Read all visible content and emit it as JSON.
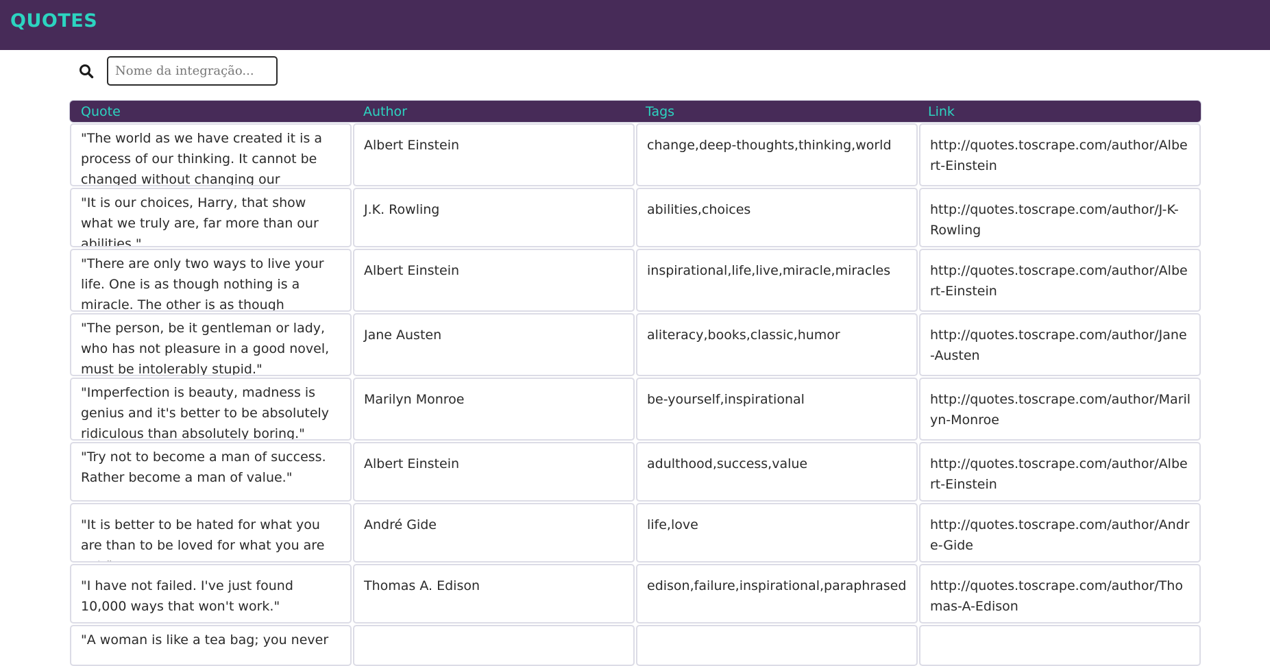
{
  "app": {
    "title": "QUOTES"
  },
  "search": {
    "placeholder": "Nome da integração..."
  },
  "table": {
    "headers": [
      "Quote",
      "Author",
      "Tags",
      "Link"
    ],
    "rows": [
      {
        "quote": "\"The world as we have created it is a process of our thinking. It cannot be changed without changing our thinking.\"",
        "author": "Albert Einstein",
        "tags": "change,deep-thoughts,thinking,world",
        "link": "http://quotes.toscrape.com/author/Albert-Einstein"
      },
      {
        "quote": "\"It is our choices, Harry, that show what we truly are, far more than our abilities.\"",
        "author": "J.K. Rowling",
        "tags": "abilities,choices",
        "link": "http://quotes.toscrape.com/author/J-K-Rowling"
      },
      {
        "quote": "\"There are only two ways to live your life. One is as though nothing is a miracle. The other is as though everything is a miracle.\"",
        "author": "Albert Einstein",
        "tags": "inspirational,life,live,miracle,miracles",
        "link": "http://quotes.toscrape.com/author/Albert-Einstein"
      },
      {
        "quote": "\"The person, be it gentleman or lady, who has not pleasure in a good novel, must be intolerably stupid.\"",
        "author": "Jane Austen",
        "tags": "aliteracy,books,classic,humor",
        "link": "http://quotes.toscrape.com/author/Jane-Austen"
      },
      {
        "quote": "\"Imperfection is beauty, madness is genius and it's better to be absolutely ridiculous than absolutely boring.\"",
        "author": "Marilyn Monroe",
        "tags": "be-yourself,inspirational",
        "link": "http://quotes.toscrape.com/author/Marilyn-Monroe"
      },
      {
        "quote": "\"Try not to become a man of success. Rather become a man of value.\"",
        "author": "Albert Einstein",
        "tags": "adulthood,success,value",
        "link": "http://quotes.toscrape.com/author/Albert-Einstein"
      },
      {
        "quote": "\"It is better to be hated for what you are than to be loved for what you are not.\"",
        "author": "André Gide",
        "tags": "life,love",
        "link": "http://quotes.toscrape.com/author/Andre-Gide"
      },
      {
        "quote": "\"I have not failed. I've just found 10,000 ways that won't work.\"",
        "author": "Thomas A. Edison",
        "tags": "edison,failure,inspirational,paraphrased",
        "link": "http://quotes.toscrape.com/author/Thomas-A-Edison"
      },
      {
        "quote": "\"A woman is like a tea bag; you never",
        "author": "",
        "tags": "",
        "link": ""
      }
    ]
  },
  "colors": {
    "header_bg": "#472b58",
    "accent": "#2cd4c0",
    "cell_border": "#dcdce6"
  },
  "icons": {
    "search": "search-icon"
  }
}
